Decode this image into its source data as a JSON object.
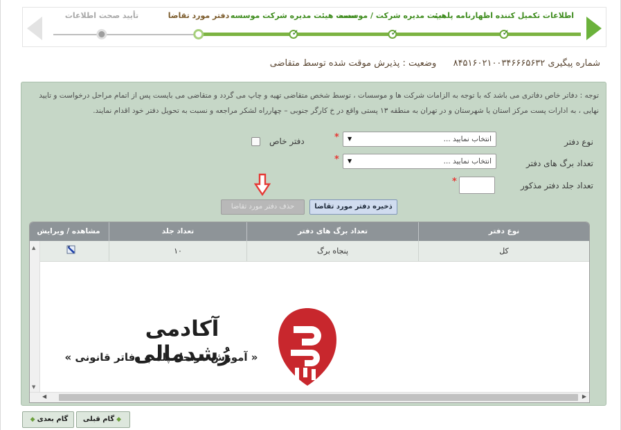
{
  "wizard": {
    "steps": [
      {
        "label": "اطلاعات تکمیل کننده اظهارنامه پلمپ",
        "state": "done"
      },
      {
        "label": "هیئت مدیره شرکت / موسسه",
        "state": "done"
      },
      {
        "label": "سمت هیئت مدیره شرکت موسسه",
        "state": "done"
      },
      {
        "label": "دفتر مورد تقاضا",
        "state": "current"
      },
      {
        "label": "تأیید صحت اطلاعات",
        "state": "pending"
      }
    ]
  },
  "tracking": {
    "number_label": "شماره پیگیری",
    "number_value": "۸۴۵۱۶۰۲۱۰۰۳۴۶۶۶۵۶۳۲",
    "status_label": "وضعیت :",
    "status_value": "پذیرش موقت شده توسط متقاضی"
  },
  "notice": {
    "text": "توجه : دفاتر خاص دفاتری می باشد که با توجه به الزامات شرکت ها و موسسات ، توسط شخص متقاضی تهیه و چاپ می گردد و متقاضی می بایست پس از اتمام مراحل درخواست و تایید نهایی ، به ادارات پست مرکز استان یا شهرستان و در تهران به منطقه ۱۳ پستی واقع در خ کارگر جنوبی – چهارراه لشکر مراجعه و نسبت به تحویل دفتر خود اقدام نمایند."
  },
  "form": {
    "book_type_label": "نوع دفتر",
    "book_type_value": "انتخاب نمایید ...",
    "special_book_label": "دفتر خاص",
    "pages_label": "تعداد برگ های دفتر",
    "pages_value": "انتخاب نمایید ...",
    "volumes_label": "تعداد جلد دفتر مذکور",
    "volumes_value": "",
    "required_mark": "*",
    "save_button": "ذخیره دفتر مورد تقاضا",
    "delete_button": "حذف دفتر مورد تقاضا"
  },
  "grid": {
    "headers": {
      "book_type": "نوع دفتر",
      "pages": "تعداد برگ های دفتر",
      "volumes": "تعداد جلد",
      "view_edit": "مشاهده / ویرایش"
    },
    "rows": [
      {
        "book_type": "کل",
        "pages": "پنجاه برگ",
        "volumes": "۱۰"
      }
    ]
  },
  "watermark": {
    "title": "آکادمی رُشدمالی",
    "subtitle": "« آموزش مراحل پلمپ دفاتر قانونی »"
  },
  "nav": {
    "prev_label": "گام قبلی",
    "next_label": "گام بعدی"
  },
  "colors": {
    "accent_green": "#6bb23b",
    "panel_bg": "#c6d7c7",
    "grid_header": "#8e9498",
    "required": "#e53935",
    "logo_red": "#c8272d"
  }
}
